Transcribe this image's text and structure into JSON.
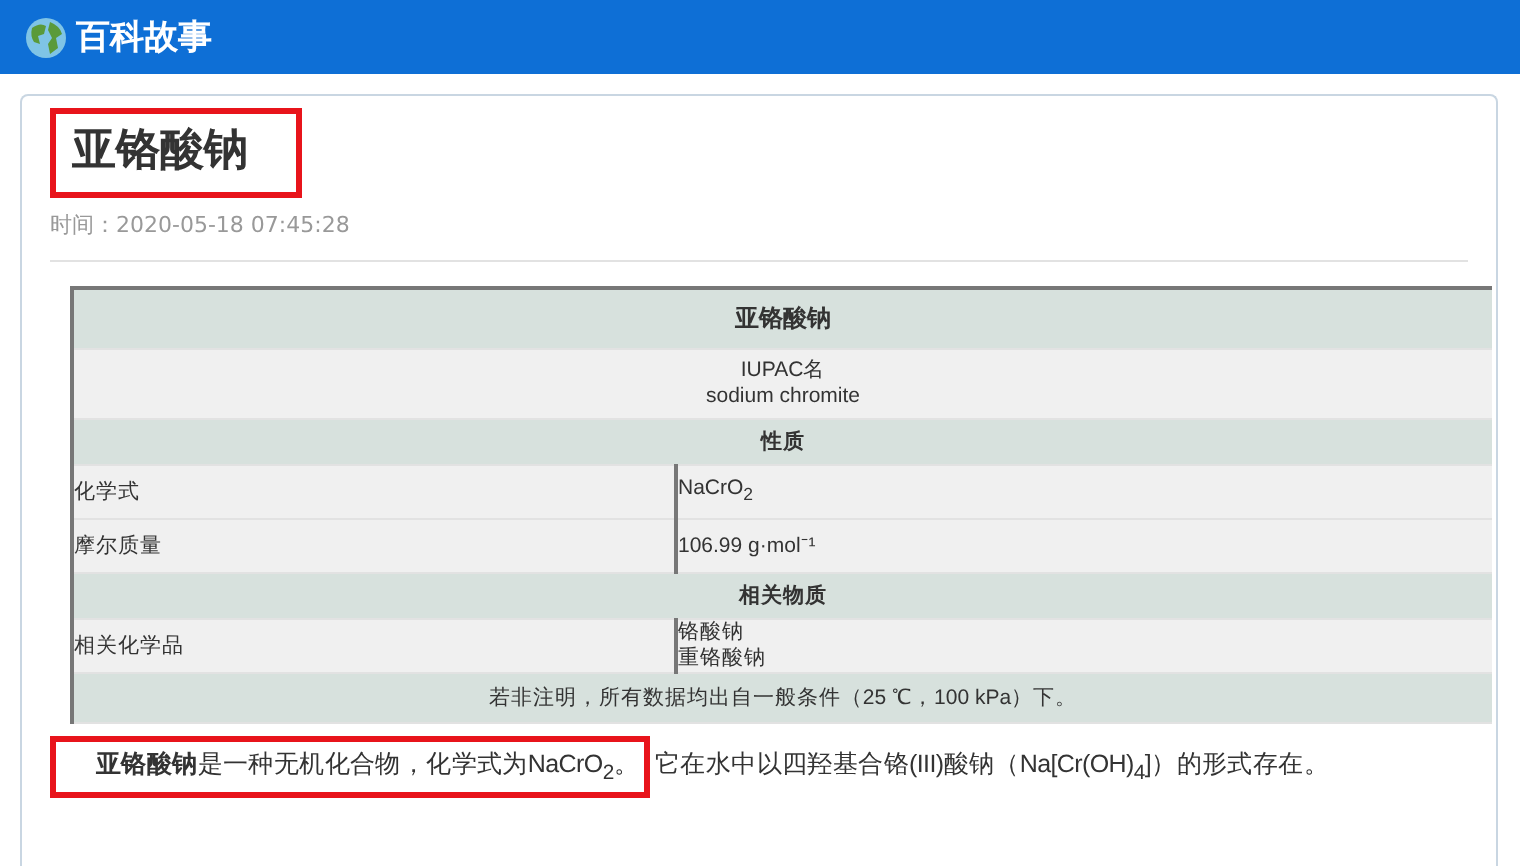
{
  "header": {
    "site_name": "百科故事"
  },
  "article": {
    "title": "亚铬酸钠",
    "title_highlighted": true,
    "time": "时间：2020-05-18 07:45:28",
    "infobox": [
      {
        "kind": "title",
        "text": "亚铬酸钠"
      },
      {
        "kind": "center",
        "lines": [
          "IUPAC名",
          "sodium chromite"
        ]
      },
      {
        "kind": "section",
        "text": "性质"
      },
      {
        "kind": "pair",
        "label": "化学式",
        "values": [
          "NaCrO$_{2}$"
        ]
      },
      {
        "kind": "pair",
        "label": "摩尔质量",
        "values": [
          "106.99 g·mol⁻¹"
        ]
      },
      {
        "kind": "section",
        "text": "相关物质"
      },
      {
        "kind": "pair",
        "label": "相关化学品",
        "values": [
          "铬酸钠",
          "重铬酸钠"
        ]
      },
      {
        "kind": "note",
        "text": "若非注明，所有数据均出自一般条件（25 ℃，100 kPa）下。"
      }
    ],
    "paragraph": [
      {
        "text": "**亚铬酸钠**是一种无机化合物，化学式为NaCrO$_{2}$。",
        "highlighted": true
      },
      {
        "text": "它在水中以四羟基合铬(III)酸钠（Na[Cr(OH)$_{4}$]）的形式存在。",
        "highlighted": false
      }
    ]
  }
}
